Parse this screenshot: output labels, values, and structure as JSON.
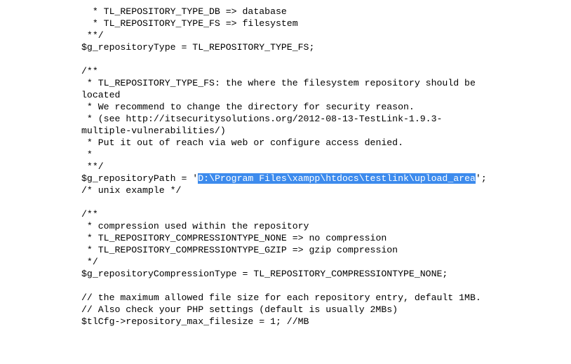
{
  "document": {
    "kind": "source-code-text",
    "language": "php",
    "background_color": "#ffffff",
    "text_color": "#000000"
  },
  "selection": {
    "highlight_color": "#3d8bed",
    "highlight_text_color": "#ffffff",
    "selected_text": "D:\\Program Files\\xampp\\htdocs\\testlink\\upload_area",
    "is_active": true
  },
  "code": {
    "segment_1": "  * TL_REPOSITORY_TYPE_DB => database\n  * TL_REPOSITORY_TYPE_FS => filesystem\n **/\n$g_repositoryType = TL_REPOSITORY_TYPE_FS;\n\n/**\n * TL_REPOSITORY_TYPE_FS: the where the filesystem repository should be located\n * We recommend to change the directory for security reason.\n * (see http://itsecuritysolutions.org/2012-08-13-TestLink-1.9.3-multiple-vulnerabilities/)\n * Put it out of reach via web or configure access denied.\n *\n **/\n$g_repositoryPath = '",
    "selected_path": "D:\\Program Files\\xampp\\htdocs\\testlink\\upload_area",
    "segment_2": "';  /* unix example */\n\n/**\n * compression used within the repository\n * TL_REPOSITORY_COMPRESSIONTYPE_NONE => no compression\n * TL_REPOSITORY_COMPRESSIONTYPE_GZIP => gzip compression\n */\n$g_repositoryCompressionType = TL_REPOSITORY_COMPRESSIONTYPE_NONE;\n\n// the maximum allowed file size for each repository entry, default 1MB.\n// Also check your PHP settings (default is usually 2MBs)\n$tlCfg->repository_max_filesize = 1; //MB\n"
  }
}
